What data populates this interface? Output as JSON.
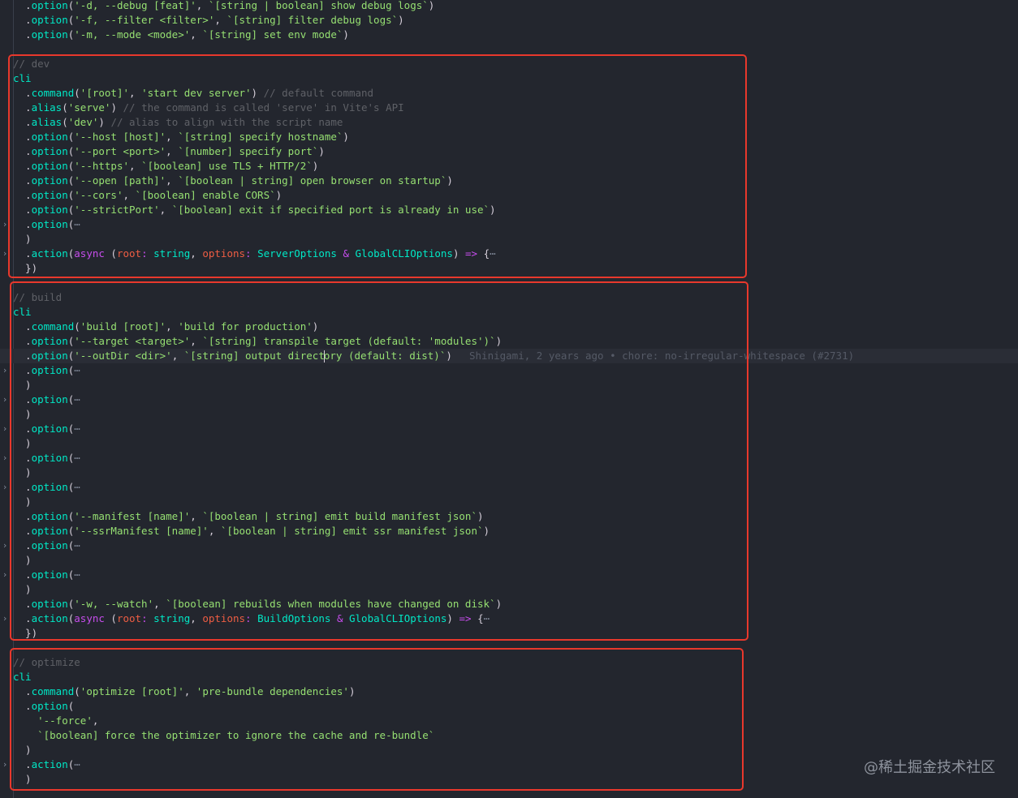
{
  "colors": {
    "background": "#23262e",
    "keyword": "#c74ded",
    "identifier": "#00e8c6",
    "string": "#96e072",
    "comment": "#5f6167",
    "parameter": "#ee5d43",
    "fold_marker": "#7f8797",
    "highlight_box": "#e8382c"
  },
  "icons": {
    "fold_collapsed": "chevron-right-icon",
    "fold_ellipsis": "ellipsis"
  },
  "blame": {
    "author": "Shinigami",
    "when": "2 years ago",
    "message": "chore: no-irregular-whitespace (#2731)",
    "text": "Shinigami, 2 years ago • chore: no-irregular-whitespace (#2731)"
  },
  "watermark": "@稀土掘金技术社区",
  "lines": [
    {
      "fold": false,
      "tokens": [
        [
          "pu",
          "  ."
        ],
        [
          "ty",
          "option"
        ],
        [
          "pu",
          "("
        ],
        [
          "st",
          "'-d, --debug [feat]'"
        ],
        [
          "pu",
          ", "
        ],
        [
          "st",
          "`[string | boolean] show debug logs`"
        ],
        [
          "pu",
          ")"
        ]
      ]
    },
    {
      "fold": false,
      "tokens": [
        [
          "pu",
          "  ."
        ],
        [
          "ty",
          "option"
        ],
        [
          "pu",
          "("
        ],
        [
          "st",
          "'-f, --filter <filter>'"
        ],
        [
          "pu",
          ", "
        ],
        [
          "st",
          "`[string] filter debug logs`"
        ],
        [
          "pu",
          ")"
        ]
      ]
    },
    {
      "fold": false,
      "tokens": [
        [
          "pu",
          "  ."
        ],
        [
          "ty",
          "option"
        ],
        [
          "pu",
          "("
        ],
        [
          "st",
          "'-m, --mode <mode>'"
        ],
        [
          "pu",
          ", "
        ],
        [
          "st",
          "`[string] set env mode`"
        ],
        [
          "pu",
          ")"
        ]
      ]
    },
    {
      "fold": false,
      "tokens": []
    },
    {
      "fold": false,
      "tokens": [
        [
          "cm",
          "// dev"
        ]
      ]
    },
    {
      "fold": false,
      "tokens": [
        [
          "ty",
          "cli"
        ]
      ]
    },
    {
      "fold": false,
      "tokens": [
        [
          "pu",
          "  ."
        ],
        [
          "ty",
          "command"
        ],
        [
          "pu",
          "("
        ],
        [
          "st",
          "'[root]'"
        ],
        [
          "pu",
          ", "
        ],
        [
          "st",
          "'start dev server'"
        ],
        [
          "pu",
          ") "
        ],
        [
          "cm",
          "// default command"
        ]
      ]
    },
    {
      "fold": false,
      "tokens": [
        [
          "pu",
          "  ."
        ],
        [
          "ty",
          "alias"
        ],
        [
          "pu",
          "("
        ],
        [
          "st",
          "'serve'"
        ],
        [
          "pu",
          ") "
        ],
        [
          "cm",
          "// the command is called 'serve' in Vite's API"
        ]
      ]
    },
    {
      "fold": false,
      "tokens": [
        [
          "pu",
          "  ."
        ],
        [
          "ty",
          "alias"
        ],
        [
          "pu",
          "("
        ],
        [
          "st",
          "'dev'"
        ],
        [
          "pu",
          ") "
        ],
        [
          "cm",
          "// alias to align with the script name"
        ]
      ]
    },
    {
      "fold": false,
      "tokens": [
        [
          "pu",
          "  ."
        ],
        [
          "ty",
          "option"
        ],
        [
          "pu",
          "("
        ],
        [
          "st",
          "'--host [host]'"
        ],
        [
          "pu",
          ", "
        ],
        [
          "st",
          "`[string] specify hostname`"
        ],
        [
          "pu",
          ")"
        ]
      ]
    },
    {
      "fold": false,
      "tokens": [
        [
          "pu",
          "  ."
        ],
        [
          "ty",
          "option"
        ],
        [
          "pu",
          "("
        ],
        [
          "st",
          "'--port <port>'"
        ],
        [
          "pu",
          ", "
        ],
        [
          "st",
          "`[number] specify port`"
        ],
        [
          "pu",
          ")"
        ]
      ]
    },
    {
      "fold": false,
      "tokens": [
        [
          "pu",
          "  ."
        ],
        [
          "ty",
          "option"
        ],
        [
          "pu",
          "("
        ],
        [
          "st",
          "'--https'"
        ],
        [
          "pu",
          ", "
        ],
        [
          "st",
          "`[boolean] use TLS + HTTP/2`"
        ],
        [
          "pu",
          ")"
        ]
      ]
    },
    {
      "fold": false,
      "tokens": [
        [
          "pu",
          "  ."
        ],
        [
          "ty",
          "option"
        ],
        [
          "pu",
          "("
        ],
        [
          "st",
          "'--open [path]'"
        ],
        [
          "pu",
          ", "
        ],
        [
          "st",
          "`[boolean | string] open browser on startup`"
        ],
        [
          "pu",
          ")"
        ]
      ]
    },
    {
      "fold": false,
      "tokens": [
        [
          "pu",
          "  ."
        ],
        [
          "ty",
          "option"
        ],
        [
          "pu",
          "("
        ],
        [
          "st",
          "'--cors'"
        ],
        [
          "pu",
          ", "
        ],
        [
          "st",
          "`[boolean] enable CORS`"
        ],
        [
          "pu",
          ")"
        ]
      ]
    },
    {
      "fold": false,
      "tokens": [
        [
          "pu",
          "  ."
        ],
        [
          "ty",
          "option"
        ],
        [
          "pu",
          "("
        ],
        [
          "st",
          "'--strictPort'"
        ],
        [
          "pu",
          ", "
        ],
        [
          "st",
          "`[boolean] exit if specified port is already in use`"
        ],
        [
          "pu",
          ")"
        ]
      ]
    },
    {
      "fold": true,
      "tokens": [
        [
          "pu",
          "  ."
        ],
        [
          "ty",
          "option"
        ],
        [
          "pu",
          "("
        ],
        [
          "fo",
          "⋯"
        ]
      ]
    },
    {
      "fold": false,
      "tokens": [
        [
          "pu",
          "  )"
        ]
      ]
    },
    {
      "fold": true,
      "tokens": [
        [
          "pu",
          "  ."
        ],
        [
          "ty",
          "action"
        ],
        [
          "pu",
          "("
        ],
        [
          "kw",
          "async"
        ],
        [
          "pu",
          " ("
        ],
        [
          "pa",
          "root"
        ],
        [
          "kw",
          ": "
        ],
        [
          "ty",
          "string"
        ],
        [
          "pu",
          ", "
        ],
        [
          "pa",
          "options"
        ],
        [
          "kw",
          ": "
        ],
        [
          "ty",
          "ServerOptions"
        ],
        [
          "kw",
          " & "
        ],
        [
          "ty",
          "GlobalCLIOptions"
        ],
        [
          "pu",
          ") "
        ],
        [
          "kw",
          "=>"
        ],
        [
          "pu",
          " {"
        ],
        [
          "fo",
          "⋯"
        ]
      ]
    },
    {
      "fold": false,
      "tokens": [
        [
          "pu",
          "  })"
        ]
      ]
    },
    {
      "fold": false,
      "tokens": []
    },
    {
      "fold": false,
      "tokens": [
        [
          "cm",
          "// build"
        ]
      ]
    },
    {
      "fold": false,
      "tokens": [
        [
          "ty",
          "cli"
        ]
      ]
    },
    {
      "fold": false,
      "tokens": [
        [
          "pu",
          "  ."
        ],
        [
          "ty",
          "command"
        ],
        [
          "pu",
          "("
        ],
        [
          "st",
          "'build [root]'"
        ],
        [
          "pu",
          ", "
        ],
        [
          "st",
          "'build for production'"
        ],
        [
          "pu",
          ")"
        ]
      ]
    },
    {
      "fold": false,
      "tokens": [
        [
          "pu",
          "  ."
        ],
        [
          "ty",
          "option"
        ],
        [
          "pu",
          "("
        ],
        [
          "st",
          "'--target <target>'"
        ],
        [
          "pu",
          ", "
        ],
        [
          "st",
          "`[string] transpile target (default: 'modules')`"
        ],
        [
          "pu",
          ")"
        ]
      ]
    },
    {
      "fold": false,
      "active": true,
      "blame": true,
      "tokens": [
        [
          "pu",
          "  ."
        ],
        [
          "ty",
          "option"
        ],
        [
          "pu",
          "("
        ],
        [
          "st",
          "'--outDir <dir>'"
        ],
        [
          "pu",
          ", "
        ],
        [
          "st",
          "`[string] output direct"
        ],
        [
          "cursor",
          ""
        ],
        [
          "st",
          "ory (default: dist)`"
        ],
        [
          "pu",
          ")"
        ]
      ]
    },
    {
      "fold": true,
      "tokens": [
        [
          "pu",
          "  ."
        ],
        [
          "ty",
          "option"
        ],
        [
          "pu",
          "("
        ],
        [
          "fo",
          "⋯"
        ]
      ]
    },
    {
      "fold": false,
      "tokens": [
        [
          "pu",
          "  )"
        ]
      ]
    },
    {
      "fold": true,
      "tokens": [
        [
          "pu",
          "  ."
        ],
        [
          "ty",
          "option"
        ],
        [
          "pu",
          "("
        ],
        [
          "fo",
          "⋯"
        ]
      ]
    },
    {
      "fold": false,
      "tokens": [
        [
          "pu",
          "  )"
        ]
      ]
    },
    {
      "fold": true,
      "tokens": [
        [
          "pu",
          "  ."
        ],
        [
          "ty",
          "option"
        ],
        [
          "pu",
          "("
        ],
        [
          "fo",
          "⋯"
        ]
      ]
    },
    {
      "fold": false,
      "tokens": [
        [
          "pu",
          "  )"
        ]
      ]
    },
    {
      "fold": true,
      "tokens": [
        [
          "pu",
          "  ."
        ],
        [
          "ty",
          "option"
        ],
        [
          "pu",
          "("
        ],
        [
          "fo",
          "⋯"
        ]
      ]
    },
    {
      "fold": false,
      "tokens": [
        [
          "pu",
          "  )"
        ]
      ]
    },
    {
      "fold": true,
      "tokens": [
        [
          "pu",
          "  ."
        ],
        [
          "ty",
          "option"
        ],
        [
          "pu",
          "("
        ],
        [
          "fo",
          "⋯"
        ]
      ]
    },
    {
      "fold": false,
      "tokens": [
        [
          "pu",
          "  )"
        ]
      ]
    },
    {
      "fold": false,
      "tokens": [
        [
          "pu",
          "  ."
        ],
        [
          "ty",
          "option"
        ],
        [
          "pu",
          "("
        ],
        [
          "st",
          "'--manifest [name]'"
        ],
        [
          "pu",
          ", "
        ],
        [
          "st",
          "`[boolean | string] emit build manifest json`"
        ],
        [
          "pu",
          ")"
        ]
      ]
    },
    {
      "fold": false,
      "tokens": [
        [
          "pu",
          "  ."
        ],
        [
          "ty",
          "option"
        ],
        [
          "pu",
          "("
        ],
        [
          "st",
          "'--ssrManifest [name]'"
        ],
        [
          "pu",
          ", "
        ],
        [
          "st",
          "`[boolean | string] emit ssr manifest json`"
        ],
        [
          "pu",
          ")"
        ]
      ]
    },
    {
      "fold": true,
      "tokens": [
        [
          "pu",
          "  ."
        ],
        [
          "ty",
          "option"
        ],
        [
          "pu",
          "("
        ],
        [
          "fo",
          "⋯"
        ]
      ]
    },
    {
      "fold": false,
      "tokens": [
        [
          "pu",
          "  )"
        ]
      ]
    },
    {
      "fold": true,
      "tokens": [
        [
          "pu",
          "  ."
        ],
        [
          "ty",
          "option"
        ],
        [
          "pu",
          "("
        ],
        [
          "fo",
          "⋯"
        ]
      ]
    },
    {
      "fold": false,
      "tokens": [
        [
          "pu",
          "  )"
        ]
      ]
    },
    {
      "fold": false,
      "tokens": [
        [
          "pu",
          "  ."
        ],
        [
          "ty",
          "option"
        ],
        [
          "pu",
          "("
        ],
        [
          "st",
          "'-w, --watch'"
        ],
        [
          "pu",
          ", "
        ],
        [
          "st",
          "`[boolean] rebuilds when modules have changed on disk`"
        ],
        [
          "pu",
          ")"
        ]
      ]
    },
    {
      "fold": true,
      "tokens": [
        [
          "pu",
          "  ."
        ],
        [
          "ty",
          "action"
        ],
        [
          "pu",
          "("
        ],
        [
          "kw",
          "async"
        ],
        [
          "pu",
          " ("
        ],
        [
          "pa",
          "root"
        ],
        [
          "kw",
          ": "
        ],
        [
          "ty",
          "string"
        ],
        [
          "pu",
          ", "
        ],
        [
          "pa",
          "options"
        ],
        [
          "kw",
          ": "
        ],
        [
          "ty",
          "BuildOptions"
        ],
        [
          "kw",
          " & "
        ],
        [
          "ty",
          "GlobalCLIOptions"
        ],
        [
          "pu",
          ") "
        ],
        [
          "kw",
          "=>"
        ],
        [
          "pu",
          " {"
        ],
        [
          "fo",
          "⋯"
        ]
      ]
    },
    {
      "fold": false,
      "tokens": [
        [
          "pu",
          "  })"
        ]
      ]
    },
    {
      "fold": false,
      "tokens": []
    },
    {
      "fold": false,
      "tokens": [
        [
          "cm",
          "// optimize"
        ]
      ]
    },
    {
      "fold": false,
      "tokens": [
        [
          "ty",
          "cli"
        ]
      ]
    },
    {
      "fold": false,
      "tokens": [
        [
          "pu",
          "  ."
        ],
        [
          "ty",
          "command"
        ],
        [
          "pu",
          "("
        ],
        [
          "st",
          "'optimize [root]'"
        ],
        [
          "pu",
          ", "
        ],
        [
          "st",
          "'pre-bundle dependencies'"
        ],
        [
          "pu",
          ")"
        ]
      ]
    },
    {
      "fold": false,
      "tokens": [
        [
          "pu",
          "  ."
        ],
        [
          "ty",
          "option"
        ],
        [
          "pu",
          "("
        ]
      ]
    },
    {
      "fold": false,
      "tokens": [
        [
          "pu",
          "    "
        ],
        [
          "st",
          "'--force'"
        ],
        [
          "pu",
          ","
        ]
      ]
    },
    {
      "fold": false,
      "tokens": [
        [
          "pu",
          "    "
        ],
        [
          "st",
          "`[boolean] force the optimizer to ignore the cache and re-bundle`"
        ]
      ]
    },
    {
      "fold": false,
      "tokens": [
        [
          "pu",
          "  )"
        ]
      ]
    },
    {
      "fold": true,
      "tokens": [
        [
          "pu",
          "  ."
        ],
        [
          "ty",
          "action"
        ],
        [
          "pu",
          "("
        ],
        [
          "fo",
          "⋯"
        ]
      ]
    },
    {
      "fold": false,
      "tokens": [
        [
          "pu",
          "  )"
        ]
      ]
    }
  ]
}
